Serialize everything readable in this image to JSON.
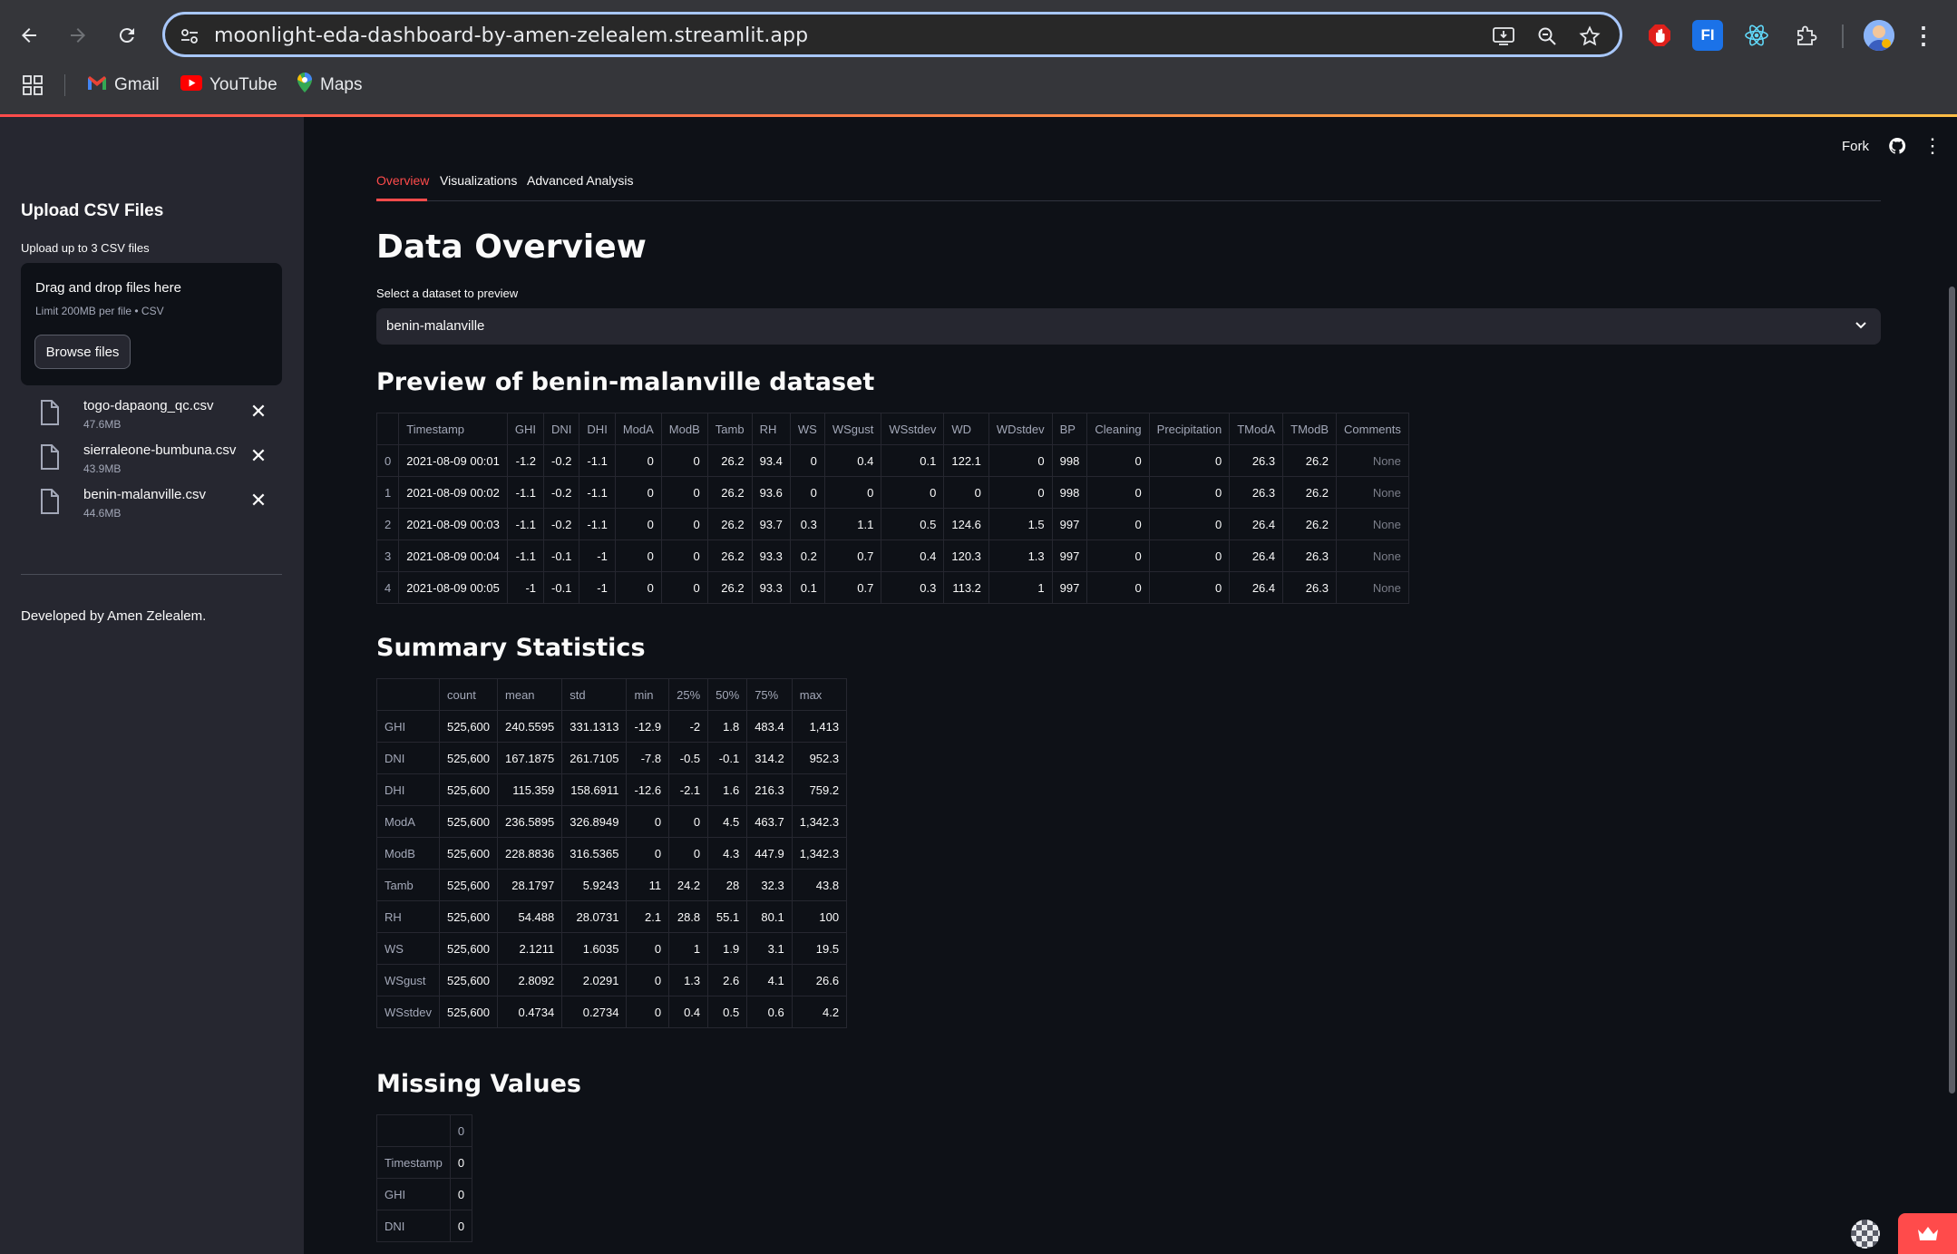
{
  "browser": {
    "url": "moonlight-eda-dashboard-by-amen-zelealem.streamlit.app",
    "bookmarks": [
      "Gmail",
      "YouTube",
      "Maps"
    ]
  },
  "sidebar": {
    "title": "Upload CSV Files",
    "subtitle": "Upload up to 3 CSV files",
    "dropzone_title": "Drag and drop files here",
    "dropzone_limit": "Limit 200MB per file • CSV",
    "browse_label": "Browse files",
    "files": [
      {
        "name": "togo-dapaong_qc.csv",
        "size": "47.6MB"
      },
      {
        "name": "sierraleone-bumbuna.csv",
        "size": "43.9MB"
      },
      {
        "name": "benin-malanville.csv",
        "size": "44.6MB"
      }
    ],
    "developer": "Developed by Amen Zelealem."
  },
  "header": {
    "fork_label": "Fork"
  },
  "tabs": [
    "Overview",
    "Visualizations",
    "Advanced Analysis"
  ],
  "main": {
    "title": "Data Overview",
    "select_label": "Select a dataset to preview",
    "select_value": "benin-malanville",
    "preview_title": "Preview of benin-malanville dataset",
    "summary_title": "Summary Statistics",
    "missing_title": "Missing Values"
  },
  "preview_table": {
    "columns": [
      "",
      "Timestamp",
      "GHI",
      "DNI",
      "DHI",
      "ModA",
      "ModB",
      "Tamb",
      "RH",
      "WS",
      "WSgust",
      "WSstdev",
      "WD",
      "WDstdev",
      "BP",
      "Cleaning",
      "Precipitation",
      "TModA",
      "TModB",
      "Comments"
    ],
    "rows": [
      [
        "0",
        "2021-08-09 00:01",
        "-1.2",
        "-0.2",
        "-1.1",
        "0",
        "0",
        "26.2",
        "93.4",
        "0",
        "0.4",
        "0.1",
        "122.1",
        "0",
        "998",
        "0",
        "0",
        "26.3",
        "26.2",
        "None"
      ],
      [
        "1",
        "2021-08-09 00:02",
        "-1.1",
        "-0.2",
        "-1.1",
        "0",
        "0",
        "26.2",
        "93.6",
        "0",
        "0",
        "0",
        "0",
        "0",
        "998",
        "0",
        "0",
        "26.3",
        "26.2",
        "None"
      ],
      [
        "2",
        "2021-08-09 00:03",
        "-1.1",
        "-0.2",
        "-1.1",
        "0",
        "0",
        "26.2",
        "93.7",
        "0.3",
        "1.1",
        "0.5",
        "124.6",
        "1.5",
        "997",
        "0",
        "0",
        "26.4",
        "26.2",
        "None"
      ],
      [
        "3",
        "2021-08-09 00:04",
        "-1.1",
        "-0.1",
        "-1",
        "0",
        "0",
        "26.2",
        "93.3",
        "0.2",
        "0.7",
        "0.4",
        "120.3",
        "1.3",
        "997",
        "0",
        "0",
        "26.4",
        "26.3",
        "None"
      ],
      [
        "4",
        "2021-08-09 00:05",
        "-1",
        "-0.1",
        "-1",
        "0",
        "0",
        "26.2",
        "93.3",
        "0.1",
        "0.7",
        "0.3",
        "113.2",
        "1",
        "997",
        "0",
        "0",
        "26.4",
        "26.3",
        "None"
      ]
    ]
  },
  "summary_table": {
    "columns": [
      "",
      "count",
      "mean",
      "std",
      "min",
      "25%",
      "50%",
      "75%",
      "max"
    ],
    "rows": [
      [
        "GHI",
        "525,600",
        "240.5595",
        "331.1313",
        "-12.9",
        "-2",
        "1.8",
        "483.4",
        "1,413"
      ],
      [
        "DNI",
        "525,600",
        "167.1875",
        "261.7105",
        "-7.8",
        "-0.5",
        "-0.1",
        "314.2",
        "952.3"
      ],
      [
        "DHI",
        "525,600",
        "115.359",
        "158.6911",
        "-12.6",
        "-2.1",
        "1.6",
        "216.3",
        "759.2"
      ],
      [
        "ModA",
        "525,600",
        "236.5895",
        "326.8949",
        "0",
        "0",
        "4.5",
        "463.7",
        "1,342.3"
      ],
      [
        "ModB",
        "525,600",
        "228.8836",
        "316.5365",
        "0",
        "0",
        "4.3",
        "447.9",
        "1,342.3"
      ],
      [
        "Tamb",
        "525,600",
        "28.1797",
        "5.9243",
        "11",
        "24.2",
        "28",
        "32.3",
        "43.8"
      ],
      [
        "RH",
        "525,600",
        "54.488",
        "28.0731",
        "2.1",
        "28.8",
        "55.1",
        "80.1",
        "100"
      ],
      [
        "WS",
        "525,600",
        "2.1211",
        "1.6035",
        "0",
        "1",
        "1.9",
        "3.1",
        "19.5"
      ],
      [
        "WSgust",
        "525,600",
        "2.8092",
        "2.0291",
        "0",
        "1.3",
        "2.6",
        "4.1",
        "26.6"
      ],
      [
        "WSstdev",
        "525,600",
        "0.4734",
        "0.2734",
        "0",
        "0.4",
        "0.5",
        "0.6",
        "4.2"
      ]
    ]
  },
  "missing_table": {
    "columns": [
      "",
      "0"
    ],
    "rows": [
      [
        "Timestamp",
        "0"
      ],
      [
        "GHI",
        "0"
      ],
      [
        "DNI",
        "0"
      ]
    ]
  },
  "colors": {
    "accent": "#ff4b4b",
    "sidebar_bg": "#262730",
    "main_bg": "#0e1117"
  }
}
